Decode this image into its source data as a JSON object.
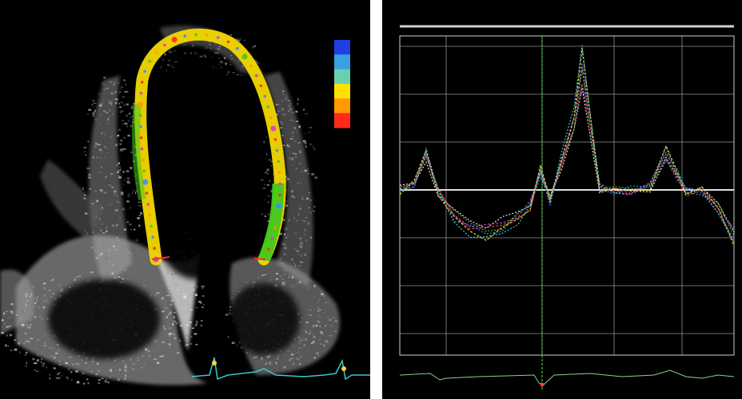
{
  "echo_view": {
    "header_left_top": "",
    "header_left_sub": "",
    "apex_marker": "",
    "scale_top_label": "",
    "scale_top_sub": "",
    "scale_bottom_label": "",
    "scale_bottom_sub": "",
    "colorbar_colors": [
      "#1f3fe0",
      "#3aa0e0",
      "#66d0b0",
      "#ffe000",
      "#ff9a00",
      "#ff2a1a"
    ],
    "trace_color": "#f2d800",
    "segment_color": "#44c81e"
  },
  "strain_view": {
    "title_text": "",
    "marker_label": "",
    "y_tick_labels": [
      "",
      "",
      "",
      "",
      "",
      "",
      ""
    ],
    "x_tick_labels": [
      "",
      "",
      "",
      "",
      ""
    ],
    "grid_color": "#cfcfcf",
    "series_colors": [
      "#ffffff",
      "#d23cd2",
      "#3cd23c",
      "#ff4040",
      "#3c8cff",
      "#ffd23c",
      "#40e0e0"
    ]
  }
}
